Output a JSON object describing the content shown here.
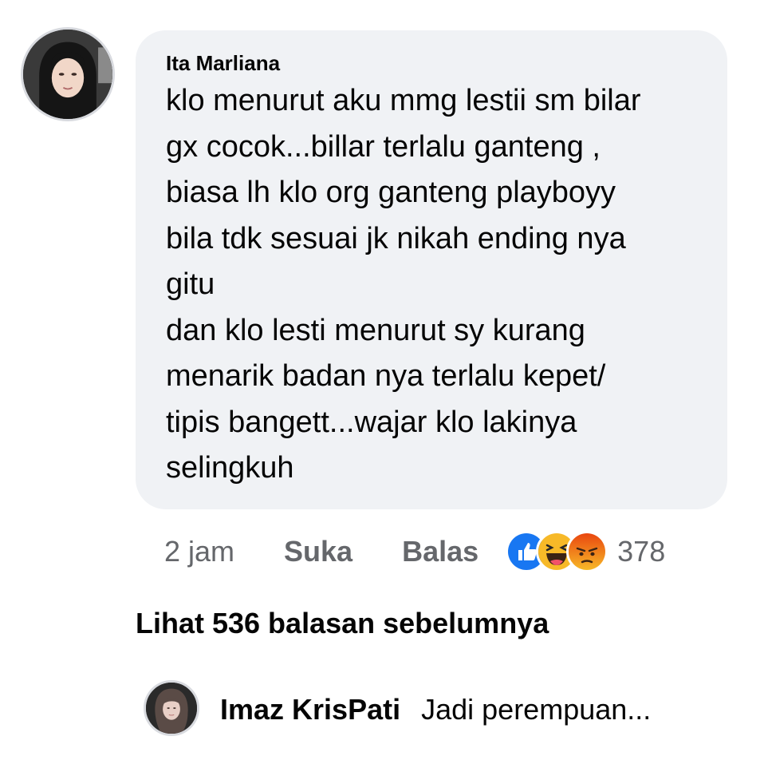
{
  "comment": {
    "author": "Ita Marliana",
    "lines": [
      "klo menurut aku mmg lestii sm bilar",
      "gx cocok...billar terlalu ganteng ,",
      "biasa lh klo org ganteng playboyy",
      "bila tdk sesuai jk nikah ending nya",
      "gitu",
      "dan klo lesti menurut sy kurang",
      "menarik badan nya terlalu kepet/",
      "tipis bangett...wajar klo lakinya",
      "selingkuh"
    ],
    "time": "2 jam",
    "like_label": "Suka",
    "reply_label": "Balas",
    "reactions": [
      "like-icon",
      "haha-icon",
      "angry-icon"
    ],
    "reaction_count": "378"
  },
  "view_previous": "Lihat 536 balasan sebelumnya",
  "reply": {
    "author": "Imaz KrisPati",
    "preview": "Jadi perempuan..."
  },
  "colors": {
    "bubble": "#f0f2f5",
    "muted_text": "#65676b",
    "like_blue": "#1877f2",
    "haha_yellow": "#f7b928",
    "angry_orange": "#e9710f"
  }
}
